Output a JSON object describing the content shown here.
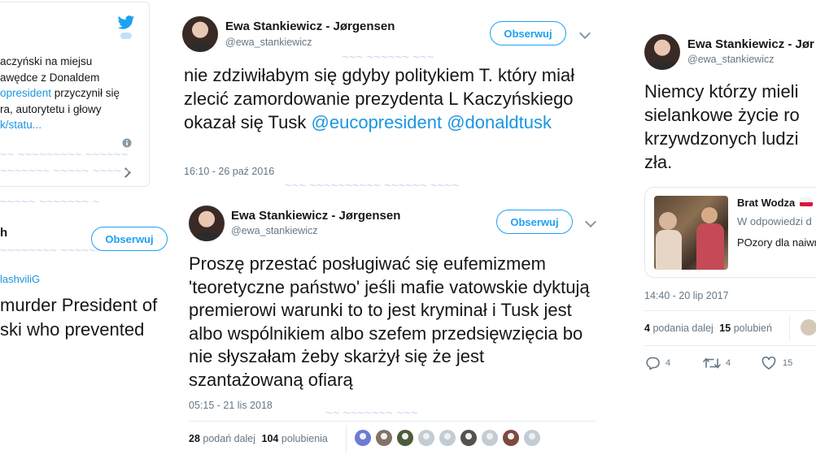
{
  "left_panel": {
    "embed_lines": [
      "aczyński na miejsu",
      "awędce z Donaldem",
      "opresident",
      " przyczynił się",
      "ra, autorytetu i głowy",
      "k/statu..."
    ],
    "author_initial": "h",
    "follow_label": "Obserwuj",
    "handle": "lashviliG",
    "text_lines": [
      "murder President of",
      "ski who prevented"
    ]
  },
  "tweet1": {
    "name": "Ewa Stankiewicz - Jørgensen",
    "handle": "@ewa_stankiewicz",
    "follow_label": "Obserwuj",
    "text_plain": "nie zdziwiłabym się gdyby politykiem T. który miał zlecić zamordowanie prezydenta L Kaczyńskiego okazał się Tusk",
    "mention1": "@eucopresident",
    "mention2": "@donaldtusk",
    "timestamp": "16:10 - 26 paź 2016"
  },
  "tweet2": {
    "name": "Ewa Stankiewicz - Jørgensen",
    "handle": "@ewa_stankiewicz",
    "follow_label": "Obserwuj",
    "text": "Proszę przestać posługiwać się eufemizmem 'teoretyczne państwo' jeśli mafie vatowskie dyktują premierowi warunki to to jest kryminał i Tusk jest albo wspólnikiem albo szefem przedsięwzięcia bo nie słyszałam żeby skarżył się że jest szantażowaną ofiarą",
    "timestamp": "05:15 - 21 lis 2018",
    "retweets_count": "28",
    "retweets_label": "podań dalej",
    "likes_count": "104",
    "likes_label": "polubienia"
  },
  "tweet3": {
    "name": "Ewa Stankiewicz - Jør",
    "handle": "@ewa_stankiewicz",
    "text_lines": [
      "Niemcy którzy mieli",
      "sielankowe życie ro",
      "krzywdzonych ludzi",
      "zła."
    ],
    "quoted": {
      "name": "Brat Wodza",
      "reply_to": "W odpowiedzi d",
      "text": "POzory dla naiwn"
    },
    "timestamp": "14:40 - 20 lip 2017",
    "retweets_count": "4",
    "retweets_label": "podania dalej",
    "likes_count": "15",
    "likes_label": "polubień",
    "action_reply": "4",
    "action_retweet": "4",
    "action_like": "15"
  },
  "colors": {
    "accent": "#1da1f2",
    "link": "#1b95e0",
    "muted": "#657786"
  }
}
